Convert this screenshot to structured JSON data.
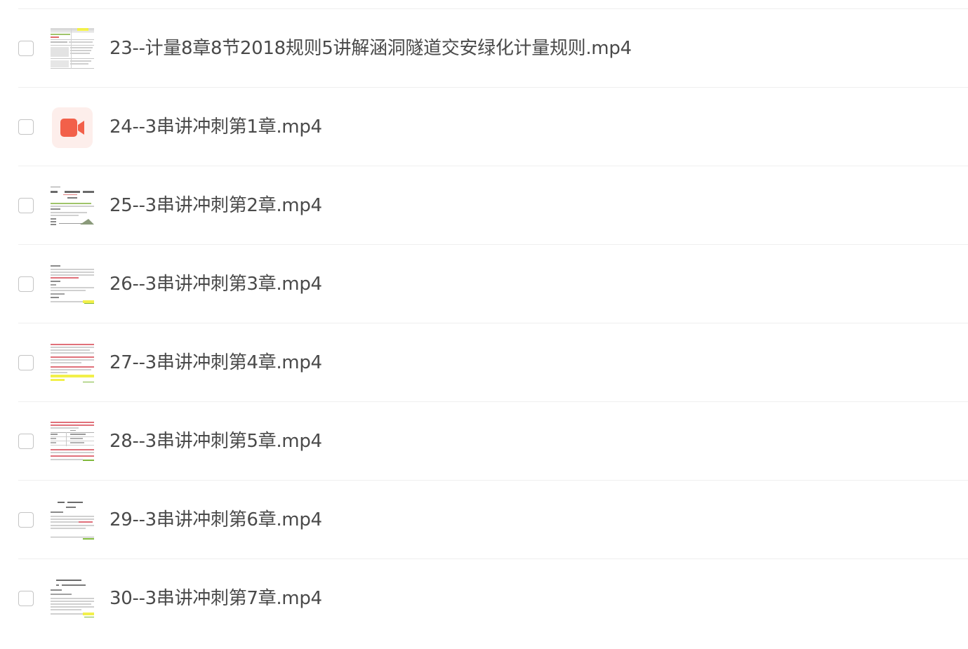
{
  "files": [
    {
      "name": "23--计量8章8节2018规则5讲解涵洞隧道交安绿化计量规则.mp4",
      "thumbnail": "spreadsheet-preview"
    },
    {
      "name": "24--3串讲冲刺第1章.mp4",
      "thumbnail": "video-icon",
      "icon_color": "#f2604a",
      "icon_bg": "#fdeeeb"
    },
    {
      "name": "25--3串讲冲刺第2章.mp4",
      "thumbnail": "document-preview"
    },
    {
      "name": "26--3串讲冲刺第3章.mp4",
      "thumbnail": "document-preview"
    },
    {
      "name": "27--3串讲冲刺第4章.mp4",
      "thumbnail": "document-preview"
    },
    {
      "name": "28--3串讲冲刺第5章.mp4",
      "thumbnail": "document-preview"
    },
    {
      "name": "29--3串讲冲刺第6章.mp4",
      "thumbnail": "document-preview"
    },
    {
      "name": "30--3串讲冲刺第7章.mp4",
      "thumbnail": "document-preview"
    }
  ],
  "colors": {
    "text": "#4a4a4a",
    "divider": "#efefef",
    "checkbox_border": "#c4c4c4",
    "highlight_yellow": "#f2f04a",
    "highlight_green": "#7fb83a",
    "red_text": "#e0707a"
  }
}
